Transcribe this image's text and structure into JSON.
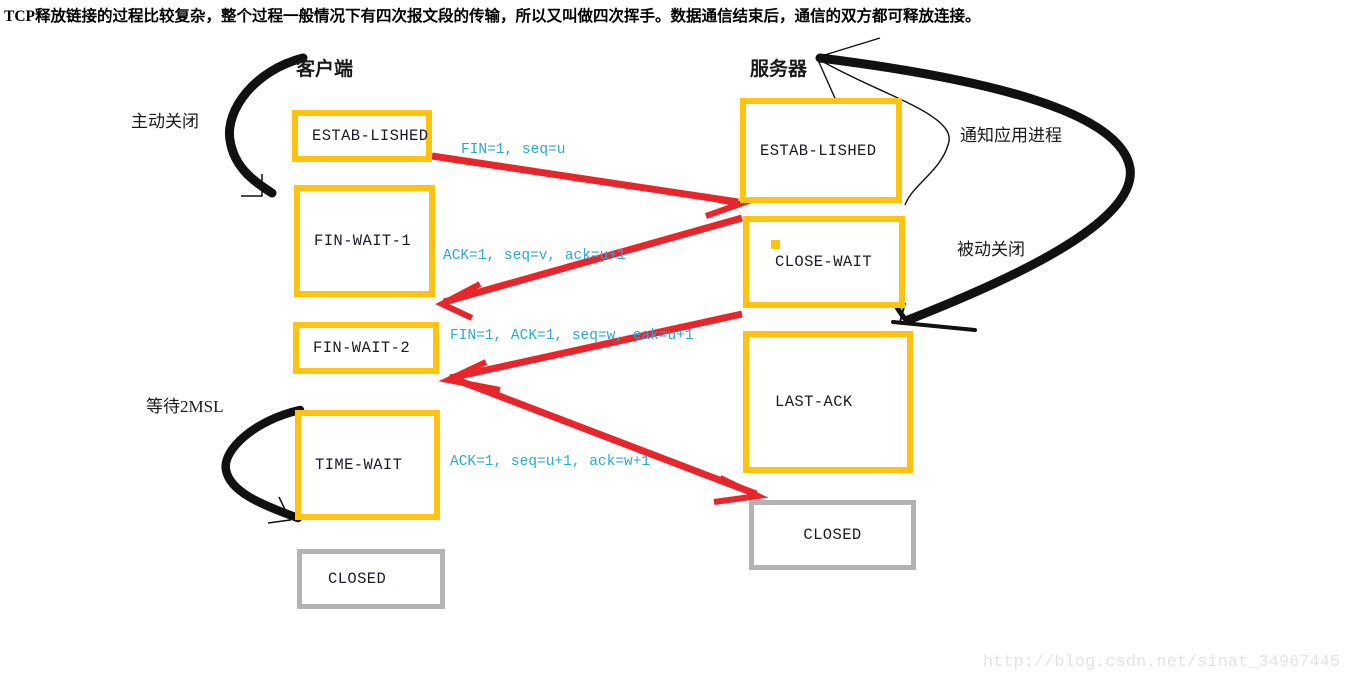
{
  "caption": "TCP释放链接的过程比较复杂，整个过程一般情况下有四次报文段的传输，所以又叫做四次挥手。数据通信结束后，通信的双方都可释放连接。",
  "sides": {
    "client": {
      "title": "客户端",
      "annotations": {
        "active_close": "主动关闭",
        "wait_2msl": "等待2MSL"
      },
      "states": [
        {
          "name": "ESTAB-LISHED",
          "style": "amber"
        },
        {
          "name": "FIN-WAIT-1",
          "style": "amber"
        },
        {
          "name": "FIN-WAIT-2",
          "style": "amber"
        },
        {
          "name": "TIME-WAIT",
          "style": "amber"
        },
        {
          "name": "CLOSED",
          "style": "grey"
        }
      ]
    },
    "server": {
      "title": "服务器",
      "annotations": {
        "notify_app": "通知应用进程",
        "passive_close": "被动关闭"
      },
      "states": [
        {
          "name": "ESTAB-LISHED",
          "style": "amber"
        },
        {
          "name": "CLOSE-WAIT",
          "style": "amber"
        },
        {
          "name": "LAST-ACK",
          "style": "amber"
        },
        {
          "name": "CLOSED",
          "style": "grey"
        }
      ]
    }
  },
  "messages": [
    {
      "text": "FIN=1, seq=u",
      "direction": "client-to-server"
    },
    {
      "text": "ACK=1, seq=v, ack=u+1",
      "direction": "server-to-client"
    },
    {
      "text": "FIN=1, ACK=1, seq=w, eak=u+1",
      "direction": "server-to-client"
    },
    {
      "text": "ACK=1, seq=u+1, ack=w+1",
      "direction": "client-to-server"
    }
  ],
  "colors": {
    "box_amber": "#FFC20E",
    "box_grey": "#B3B3B3",
    "arrow_red": "#E8252A",
    "label_blue": "#29A8E0",
    "curve_black": "#111111",
    "watermark_grey": "#e3e3e3"
  },
  "watermark": "http://blog.csdn.net/sinat_34967445"
}
